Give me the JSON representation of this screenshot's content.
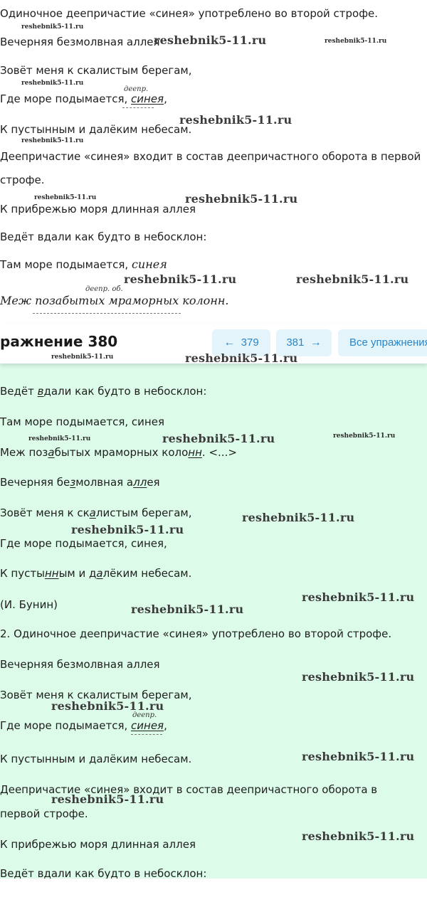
{
  "top_section": {
    "l1": "Одиночное деепричастие «синея» употреблено во второй строфе.",
    "l2": "Вечерняя безмолвная аллея",
    "l3": "Зовёт меня к скалистым берегам,",
    "l4_a": "Где море подымается, ",
    "l4_b": "синея",
    "l4_c": ",",
    "l4_label": "деепр.",
    "l5": "К пустынным и далёким небесам.",
    "l6": "Деепричастие «синея» входит в состав деепричастного оборота в первой",
    "l7": "строфе.",
    "l8": "К прибрежью моря длинная аллея",
    "l9": "Ведёт вдали как будто в небосклон:",
    "l10_a": "Там море подымается, ",
    "l10_b": "синея",
    "l11_label": "деепр. об.",
    "l11": "Меж позабытых мраморных колонн."
  },
  "header": {
    "title": "ражнение 380",
    "prev_label": "379",
    "next_label": "381",
    "all_label": "Все упражнения"
  },
  "green_section": {
    "g1_a": "Ведёт ",
    "g1_b": "в",
    "g1_c": "дали как будто в небосклон:",
    "g2": "Там море подымается, синея",
    "g3_a": "Меж поз",
    "g3_b": "а",
    "g3_c": "бытых мраморных коло",
    "g3_d": "нн",
    "g3_e": ". <...>",
    "g4_a": "Вечерняя бе",
    "g4_b": "з",
    "g4_c": "молвная а",
    "g4_d": "лл",
    "g4_e": "ея",
    "g5_a": "Зовёт меня к ск",
    "g5_b": "а",
    "g5_c": "листым берегам,",
    "g6": "Где море подымается, синея,",
    "g7_a": "К пусты",
    "g7_b": "нн",
    "g7_c": "ым и д",
    "g7_d": "а",
    "g7_e": "лёким небесам.",
    "g8": "(И. Бунин)",
    "g9": "2. Одиночное деепричастие «синея» употреблено во второй строфе.",
    "g10": "Вечерняя безмолвная аллея",
    "g11": "Зовёт меня к скалистым берегам,",
    "g12_a": "Где море подымается, ",
    "g12_b": "синея",
    "g12_c": ",",
    "g12_label": "деепр.",
    "g13": "К пустынным и далёким небесам.",
    "g14": "Деепричастие «синея» входит в состав деепричастного оборота в",
    "g15": "первой строфе.",
    "g16": "К прибрежью моря длинная аллея",
    "g17": "Ведёт вдали как будто в небосклон:"
  },
  "watermark": "reshebnik5-11.ru"
}
